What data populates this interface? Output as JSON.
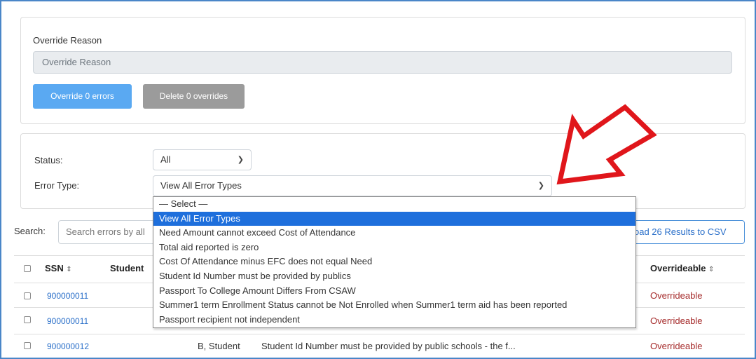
{
  "override": {
    "label": "Override Reason",
    "placeholder": "Override Reason",
    "override_button": "Override 0 errors",
    "delete_button": "Delete 0 overrides"
  },
  "filters": {
    "status_label": "Status:",
    "status_value": "All",
    "error_type_label": "Error Type:",
    "error_type_value": "View All Error Types",
    "options": [
      "— Select —",
      "View All Error Types",
      "Need Amount cannot exceed Cost of Attendance",
      "Total aid reported is zero",
      "Cost Of Attendance minus EFC does not equal Need",
      "Student Id Number must be provided by publics",
      "Passport To College Amount Differs From CSAW",
      "Summer1 term Enrollment Status cannot be Not Enrolled when Summer1 term aid has been reported",
      "Passport recipient not independent"
    ],
    "selected_index": 1
  },
  "search": {
    "label": "Search:",
    "placeholder": "Search errors by all",
    "csv_button": "oad 26 Results to CSV"
  },
  "table": {
    "headers": {
      "ssn": "SSN",
      "student": "Student",
      "overrideable": "Overrideable"
    },
    "rows": [
      {
        "ssn": "900000011",
        "student": "",
        "message": "",
        "overrideable": "Overrideable"
      },
      {
        "ssn": "900000011",
        "student": "",
        "message": "",
        "overrideable": "Overrideable"
      },
      {
        "ssn": "900000012",
        "student": "B, Student",
        "message": "Student Id Number must be provided by public schools - the f...",
        "overrideable": "Overrideable"
      }
    ]
  },
  "icons": {
    "chevron": "chevron-down-icon",
    "sort": "sort-icon",
    "annotation": "red-arrow-annotation"
  },
  "colors": {
    "primary_button": "#5aa9f2",
    "secondary_button": "#9b9b9b",
    "selected_option": "#1e6fdc",
    "link": "#2a6fc9",
    "overrideable": "#a52a2a",
    "annotation_arrow": "#e0161b"
  }
}
